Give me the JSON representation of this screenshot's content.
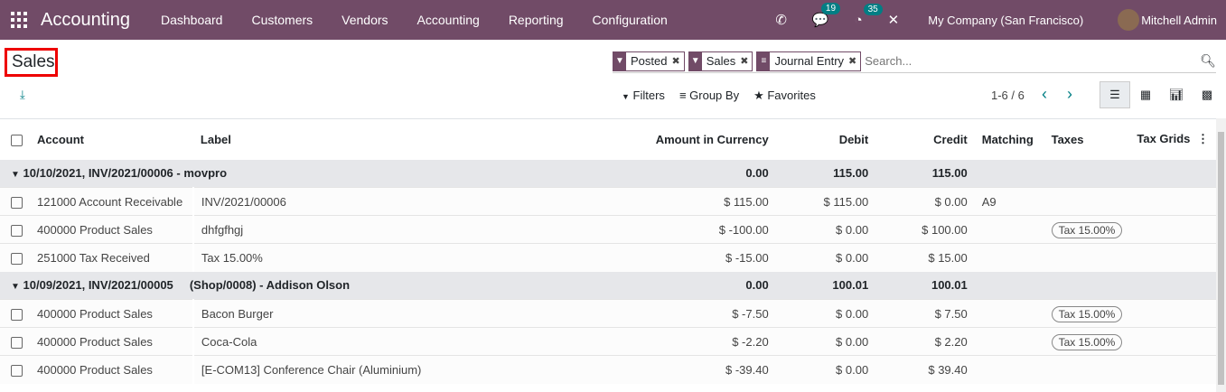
{
  "nav": {
    "app": "Accounting",
    "menu": [
      "Dashboard",
      "Customers",
      "Vendors",
      "Accounting",
      "Reporting",
      "Configuration"
    ],
    "messages": "19",
    "activities": "35",
    "company": "My Company (San Francisco)",
    "user": "Mitchell Admin"
  },
  "title": "Sales",
  "search": {
    "facets": [
      "Posted",
      "Sales",
      "Journal Entry"
    ],
    "placeholder": "Search..."
  },
  "toolbar": {
    "filters": "Filters",
    "group_by": "Group By",
    "favorites": "Favorites",
    "pager": "1-6 / 6"
  },
  "columns": [
    "Account",
    "Label",
    "Amount in Currency",
    "Debit",
    "Credit",
    "Matching",
    "Taxes",
    "Tax Grids"
  ],
  "groups": [
    {
      "name": "10/10/2021, INV/2021/00006 - movpro",
      "amount": "0.00",
      "debit": "115.00",
      "credit": "115.00",
      "rows": [
        {
          "account": "121000 Account Receivable",
          "label": "INV/2021/00006",
          "amount": "$ 115.00",
          "debit": "$ 115.00",
          "credit": "$ 0.00",
          "matching": "A9",
          "taxes": ""
        },
        {
          "account": "400000 Product Sales",
          "label": "dhfgfhgj",
          "amount": "$ -100.00",
          "debit": "$ 0.00",
          "credit": "$ 100.00",
          "matching": "",
          "taxes": "Tax 15.00%"
        },
        {
          "account": "251000 Tax Received",
          "label": "Tax 15.00%",
          "amount": "$ -15.00",
          "debit": "$ 0.00",
          "credit": "$ 15.00",
          "matching": "",
          "taxes": ""
        }
      ]
    },
    {
      "name": "10/09/2021, INV/2021/00005     (Shop/0008) - Addison Olson",
      "amount": "0.00",
      "debit": "100.01",
      "credit": "100.01",
      "rows": [
        {
          "account": "400000 Product Sales",
          "label": "Bacon Burger",
          "amount": "$ -7.50",
          "debit": "$ 0.00",
          "credit": "$ 7.50",
          "matching": "",
          "taxes": "Tax 15.00%"
        },
        {
          "account": "400000 Product Sales",
          "label": "Coca-Cola",
          "amount": "$ -2.20",
          "debit": "$ 0.00",
          "credit": "$ 2.20",
          "matching": "",
          "taxes": "Tax 15.00%"
        },
        {
          "account": "400000 Product Sales",
          "label": "[E-COM13] Conference Chair (Aluminium)",
          "amount": "$ -39.40",
          "debit": "$ 0.00",
          "credit": "$ 39.40",
          "matching": "",
          "taxes": ""
        }
      ]
    }
  ]
}
